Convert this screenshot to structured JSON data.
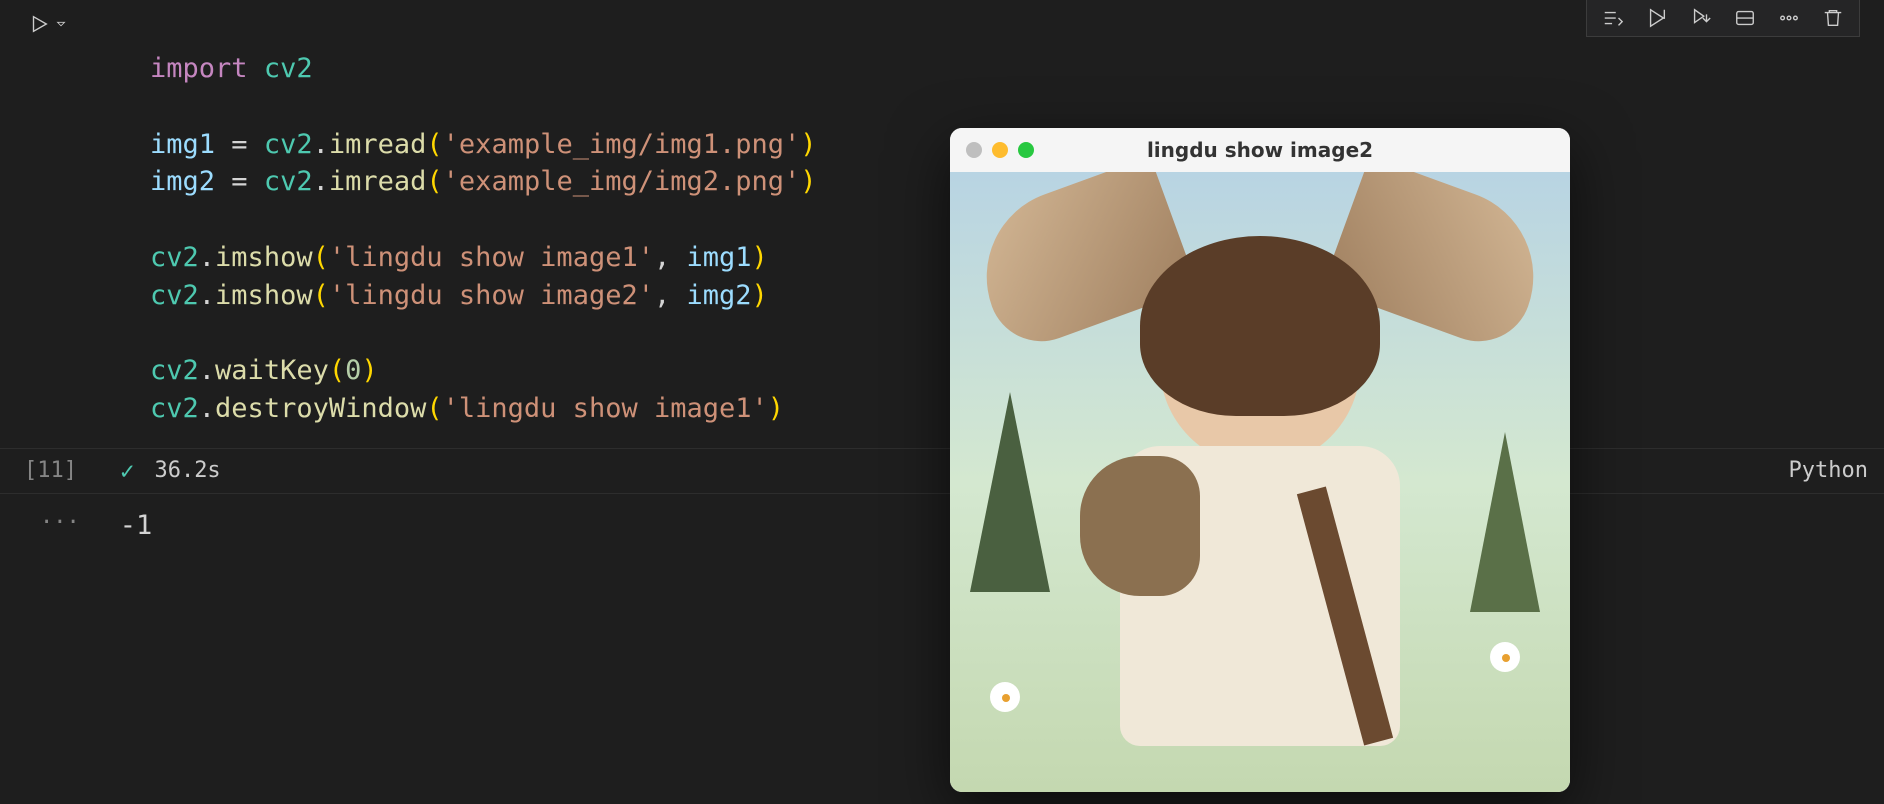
{
  "code": {
    "line1_keyword": "import",
    "line1_module": "cv2",
    "line3_var": "img1",
    "line3_op": " = ",
    "line3_mod": "cv2",
    "line3_dot": ".",
    "line3_func": "imread",
    "line3_str": "'example_img/img1.png'",
    "line4_var": "img2",
    "line4_str": "'example_img/img2.png'",
    "line6_func": "imshow",
    "line6_str": "'lingdu show image1'",
    "line6_arg": "img1",
    "line7_str": "'lingdu show image2'",
    "line7_arg": "img2",
    "line9_func": "waitKey",
    "line9_arg": "0",
    "line10_func": "destroyWindow",
    "line10_str": "'lingdu show image1'"
  },
  "execution": {
    "count": "[11]",
    "time": "36.2s",
    "kernel": "Python"
  },
  "output": {
    "dots": "···",
    "value": "-1"
  },
  "window": {
    "title": "lingdu show image2"
  }
}
